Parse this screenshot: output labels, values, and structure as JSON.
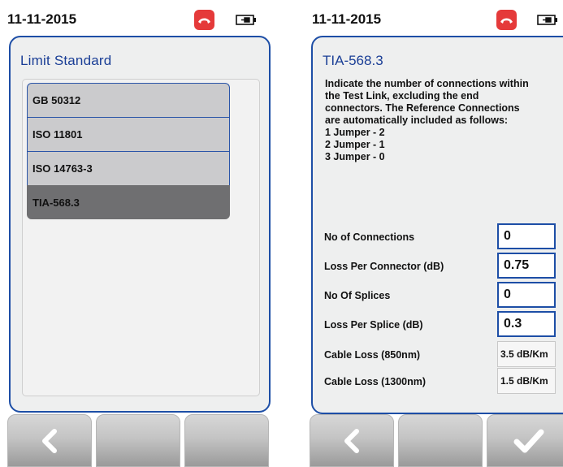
{
  "left": {
    "date": "11-11-2015",
    "title": "Limit Standard",
    "items": [
      {
        "label": "GB 50312"
      },
      {
        "label": "ISO 11801"
      },
      {
        "label": "ISO 14763-3"
      },
      {
        "label": "TIA-568.3"
      }
    ],
    "selected_item": "TIA-568.3"
  },
  "right": {
    "date": "11-11-2015",
    "title": "TIA-568.3",
    "description": [
      "Indicate the number of connections within",
      "the Test Link, excluding the end",
      "connectors. The Reference Connections",
      "are automatically included as follows:",
      "1 Jumper - 2",
      "2 Jumper - 1",
      "3 Jumper - 0"
    ],
    "fields": [
      {
        "label": "No of Connections",
        "value": "0"
      },
      {
        "label": "Loss Per Connector (dB)",
        "value": "0.75"
      },
      {
        "label": "No Of Splices",
        "value": "0"
      },
      {
        "label": "Loss Per Splice (dB)",
        "value": "0.3"
      },
      {
        "label": "Cable Loss (850nm)",
        "value": "3.5 dB/Km"
      },
      {
        "label": "Cable Loss (1300nm)",
        "value": "1.5 dB/Km"
      }
    ]
  },
  "icons": {
    "phone": "phone-hangup-icon",
    "battery": "battery-plug-icon",
    "back": "back-chevron-icon",
    "confirm": "checkmark-icon"
  },
  "colors": {
    "accent": "#1d4ea6",
    "title": "#1a3e96",
    "phone": "#e53a3a",
    "selected_item": "#6f6f71"
  }
}
